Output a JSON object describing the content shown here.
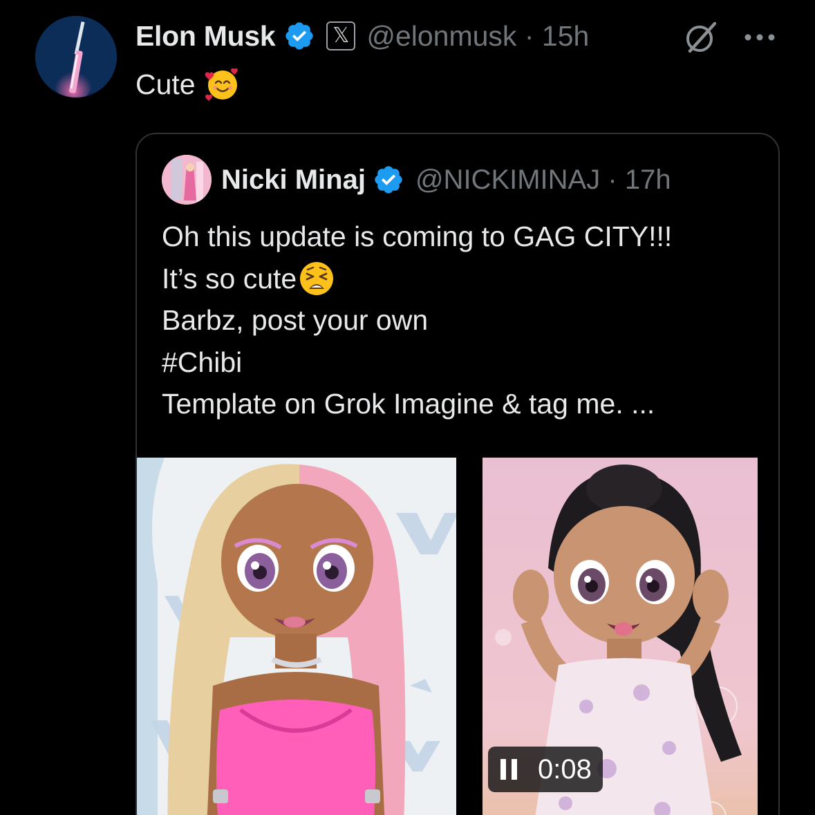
{
  "tweet": {
    "author": {
      "name": "Elon Musk",
      "handle": "@elonmusk",
      "time": "15h",
      "separator": "·",
      "badge_icon": "verified-badge-icon",
      "platform_badge": "𝕏"
    },
    "text": "Cute",
    "emoji": "smiling-face-with-hearts-icon"
  },
  "quote": {
    "author": {
      "name": "Nicki Minaj",
      "handle": "@NICKIMINAJ",
      "time": "17h",
      "separator": "·"
    },
    "lines": [
      "Oh this update is coming to GAG CITY!!!",
      "It’s so cute",
      "Barbz, post your own",
      "#Chibi",
      "Template on Grok Imagine & tag me. ..."
    ],
    "line2_emoji": "weary-face-icon",
    "media": [
      {
        "kind": "image",
        "description_icon": "chibi-doll-pink-blonde-image"
      },
      {
        "kind": "video",
        "duration": "0:08",
        "state_icon": "pause-icon"
      }
    ]
  },
  "colors": {
    "background": "#000000",
    "text": "#e7e9ea",
    "secondary_text": "#71767b",
    "border": "#2f3336",
    "verified_blue": "#1d9bf0"
  }
}
